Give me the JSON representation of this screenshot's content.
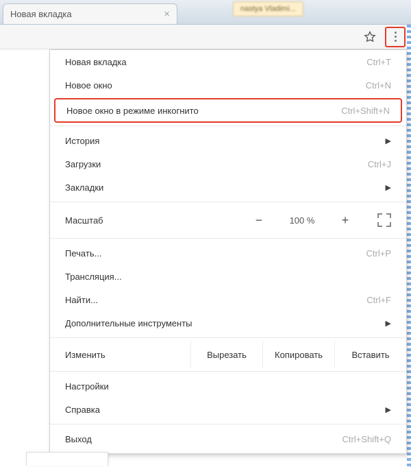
{
  "tab": {
    "title": "Новая вкладка"
  },
  "user_chip": "nastya Vladimi...",
  "menu": {
    "new_tab": {
      "label": "Новая вкладка",
      "shortcut": "Ctrl+T"
    },
    "new_window": {
      "label": "Новое окно",
      "shortcut": "Ctrl+N"
    },
    "incognito": {
      "label": "Новое окно в режиме инкогнито",
      "shortcut": "Ctrl+Shift+N"
    },
    "history": {
      "label": "История"
    },
    "downloads": {
      "label": "Загрузки",
      "shortcut": "Ctrl+J"
    },
    "bookmarks": {
      "label": "Закладки"
    },
    "zoom": {
      "label": "Масштаб",
      "value": "100 %"
    },
    "print": {
      "label": "Печать...",
      "shortcut": "Ctrl+P"
    },
    "cast": {
      "label": "Трансляция..."
    },
    "find": {
      "label": "Найти...",
      "shortcut": "Ctrl+F"
    },
    "more_tools": {
      "label": "Дополнительные инструменты"
    },
    "edit": {
      "label": "Изменить",
      "cut": "Вырезать",
      "copy": "Копировать",
      "paste": "Вставить"
    },
    "settings": {
      "label": "Настройки"
    },
    "help": {
      "label": "Справка"
    },
    "exit": {
      "label": "Выход",
      "shortcut": "Ctrl+Shift+Q"
    }
  }
}
